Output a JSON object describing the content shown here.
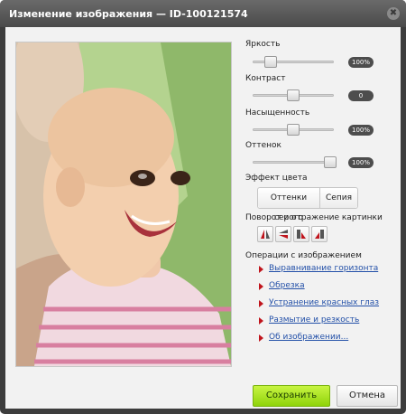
{
  "window": {
    "title": "Изменение изображения — ID-100121574",
    "close_glyph": "✖"
  },
  "adjustments": [
    {
      "label": "Яркость",
      "value_label": "100%",
      "level": 0.22
    },
    {
      "label": "Контраст",
      "value_label": "0",
      "level": 0.5
    },
    {
      "label": "Насыщенность",
      "value_label": "100%",
      "level": 0.5
    },
    {
      "label": "Оттенок",
      "value_label": "100%",
      "level": 0.97
    }
  ],
  "color_effect": {
    "label": "Эффект цвета",
    "options": [
      "Оттенки серого",
      "Сепия"
    ]
  },
  "rotate": {
    "label": "Поворот и отражение картинки",
    "buttons": [
      "flip-horizontal-icon",
      "flip-vertical-icon",
      "rotate-left-icon",
      "rotate-right-icon"
    ]
  },
  "operations": {
    "label": "Операции с изображением",
    "items": [
      "Выравнивание горизонта",
      "Обрезка",
      "Устранение красных глаз",
      "Размытие и резкость",
      "Об изображении..."
    ]
  },
  "footer": {
    "save_label": "Сохранить",
    "cancel_label": "Отмена"
  },
  "colors": {
    "accent_green": "#8fd30a",
    "link_blue": "#2350a8",
    "arrow_red": "#c0141c"
  }
}
